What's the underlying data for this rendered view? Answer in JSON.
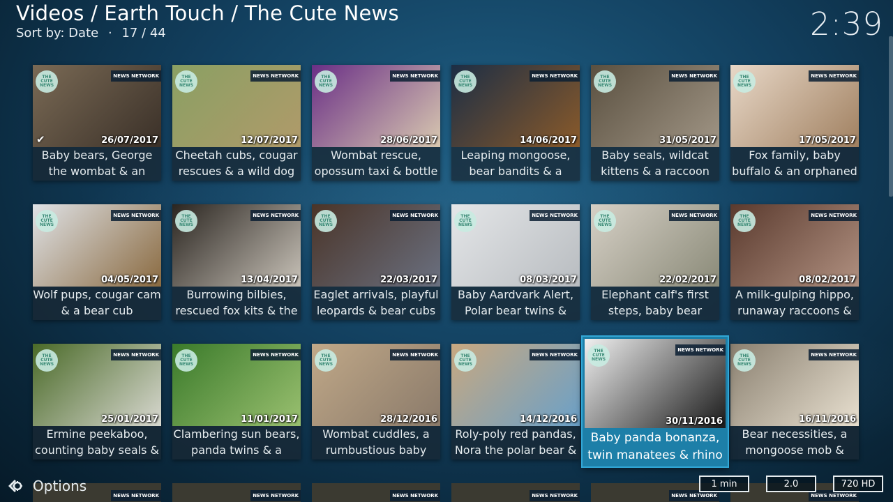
{
  "header": {
    "breadcrumb": "Videos / Earth Touch / The Cute News",
    "sort": "Sort by: Date",
    "separator": "·",
    "position": "17 / 44",
    "clock": "2:39"
  },
  "badges": {
    "cute": [
      "THE",
      "CUTE",
      "NEWS"
    ],
    "network": "NEWS NETWORK"
  },
  "tiles": [
    {
      "label": "Baby bears, George the wombat & an",
      "date": "26/07/2017",
      "watched": true,
      "colors": [
        "#7a6a55",
        "#3a3028"
      ]
    },
    {
      "label": "Cheetah cubs, cougar rescues & a wild dog",
      "date": "12/07/2017",
      "watched": false,
      "colors": [
        "#8aa063",
        "#b09a6a"
      ]
    },
    {
      "label": "Wombat rescue, opossum taxi & bottle",
      "date": "28/06/2017",
      "watched": false,
      "colors": [
        "#6a2f86",
        "#d8c8b0"
      ]
    },
    {
      "label": "Leaping mongoose, bear bandits & a",
      "date": "14/06/2017",
      "watched": false,
      "colors": [
        "#1c2e45",
        "#8a5a2a"
      ]
    },
    {
      "label": "Baby seals, wildcat kittens & a raccoon",
      "date": "31/05/2017",
      "watched": false,
      "colors": [
        "#5a5040",
        "#a09585"
      ]
    },
    {
      "label": "Fox family, baby buffalo & an orphaned",
      "date": "17/05/2017",
      "watched": false,
      "colors": [
        "#e8d8c8",
        "#a08060"
      ]
    },
    {
      "label": "Wolf pups, cougar cam & a bear cub",
      "date": "04/05/2017",
      "watched": false,
      "colors": [
        "#dfe2e6",
        "#8a6a40"
      ]
    },
    {
      "label": "Burrowing bilbies, rescued fox kits & the",
      "date": "13/04/2017",
      "watched": false,
      "colors": [
        "#2a2520",
        "#c8c2b8"
      ]
    },
    {
      "label": "Eaglet arrivals, playful leopards & bear cubs",
      "date": "22/03/2017",
      "watched": false,
      "colors": [
        "#4a3428",
        "#6a7080"
      ]
    },
    {
      "label": "Baby Aardvark Alert, Polar bear twins &",
      "date": "08/03/2017",
      "watched": false,
      "colors": [
        "#e4e6e8",
        "#b8bcc0"
      ]
    },
    {
      "label": "Elephant calf's first steps, baby bear",
      "date": "22/02/2017",
      "watched": false,
      "colors": [
        "#d6d0c6",
        "#8a8a78"
      ]
    },
    {
      "label": "A milk-gulping hippo, runaway raccoons &",
      "date": "08/02/2017",
      "watched": false,
      "colors": [
        "#5a3a2e",
        "#b09080"
      ]
    },
    {
      "label": "Ermine peekaboo, counting baby seals &",
      "date": "25/01/2017",
      "watched": false,
      "colors": [
        "#4a6a28",
        "#d8d8d0"
      ]
    },
    {
      "label": "Clambering sun bears, panda twins & a",
      "date": "11/01/2017",
      "watched": false,
      "colors": [
        "#3a7a2a",
        "#9ac070"
      ]
    },
    {
      "label": "Wombat cuddles, a rumbustious baby",
      "date": "28/12/2016",
      "watched": false,
      "colors": [
        "#c0a888",
        "#8a7a6a"
      ]
    },
    {
      "label": "Roly-poly red pandas, Nora the polar bear &",
      "date": "14/12/2016",
      "watched": false,
      "colors": [
        "#c8a880",
        "#6aa0c8"
      ]
    },
    {
      "label": "Baby panda bonanza, twin manatees & rhino",
      "date": "30/11/2016",
      "watched": false,
      "colors": [
        "#f0f0f0",
        "#1a1a1a"
      ]
    },
    {
      "label": "Bear necessities, a mongoose mob &",
      "date": "16/11/2016",
      "watched": false,
      "colors": [
        "#8a8070",
        "#e8e0d0"
      ]
    }
  ],
  "footer": {
    "options_label": "Options",
    "duration": "1 min",
    "audio": "2.0",
    "video": "720 HD"
  },
  "colors": {
    "focus": "#1d7fa8",
    "focus_border": "#32a7d6",
    "text": "#e6ecef"
  }
}
